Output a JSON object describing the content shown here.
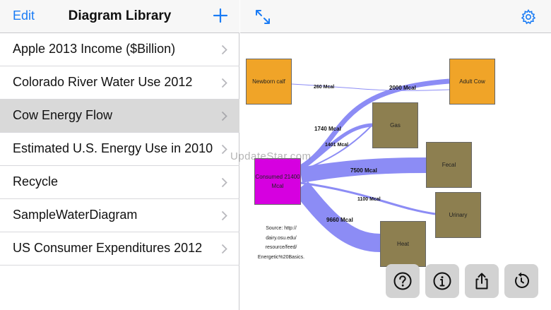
{
  "sidebar": {
    "edit_label": "Edit",
    "title": "Diagram Library",
    "add_icon": "plus-icon",
    "items": [
      {
        "label": "Apple 2013 Income ($Billion)"
      },
      {
        "label": "Colorado River Water Use 2012"
      },
      {
        "label": "Cow Energy Flow"
      },
      {
        "label": "Estimated U.S. Energy Use in 2010"
      },
      {
        "label": "Recycle"
      },
      {
        "label": "SampleWaterDiagram"
      },
      {
        "label": "US Consumer Expenditures 2012"
      }
    ],
    "selected_index": 2
  },
  "toolbar": {
    "expand_icon": "expand-icon",
    "settings_icon": "gear-icon"
  },
  "diagram": {
    "nodes": {
      "newborn": "Newborn calf",
      "adult": "Adult Cow",
      "gas": "Gas",
      "consumed": "Consumed 21400 Mcal",
      "fecal": "Fecal",
      "urinary": "Urinary",
      "heat": "Heat"
    },
    "flows": {
      "newborn_adult": "260 Mcal",
      "consumed_adult": "2000 Mcal",
      "consumed_gas_a": "1740 Mcal",
      "consumed_gas_b": "1401 Mcal",
      "consumed_fecal": "7500 Mcal",
      "consumed_urinary": "1100 Mcal",
      "consumed_heat": "9660 Mcal"
    },
    "source_lines": [
      "Source: http://",
      "dairy.osu.edu/",
      "resource/feed/",
      "Energetic%20Basics."
    ],
    "watermark": "UpdateStar.com",
    "flow_color": "#8c8cf5"
  },
  "actions": {
    "help_icon": "question-circle-icon",
    "info_icon": "info-circle-icon",
    "share_icon": "share-icon",
    "refresh_icon": "refresh-icon"
  }
}
